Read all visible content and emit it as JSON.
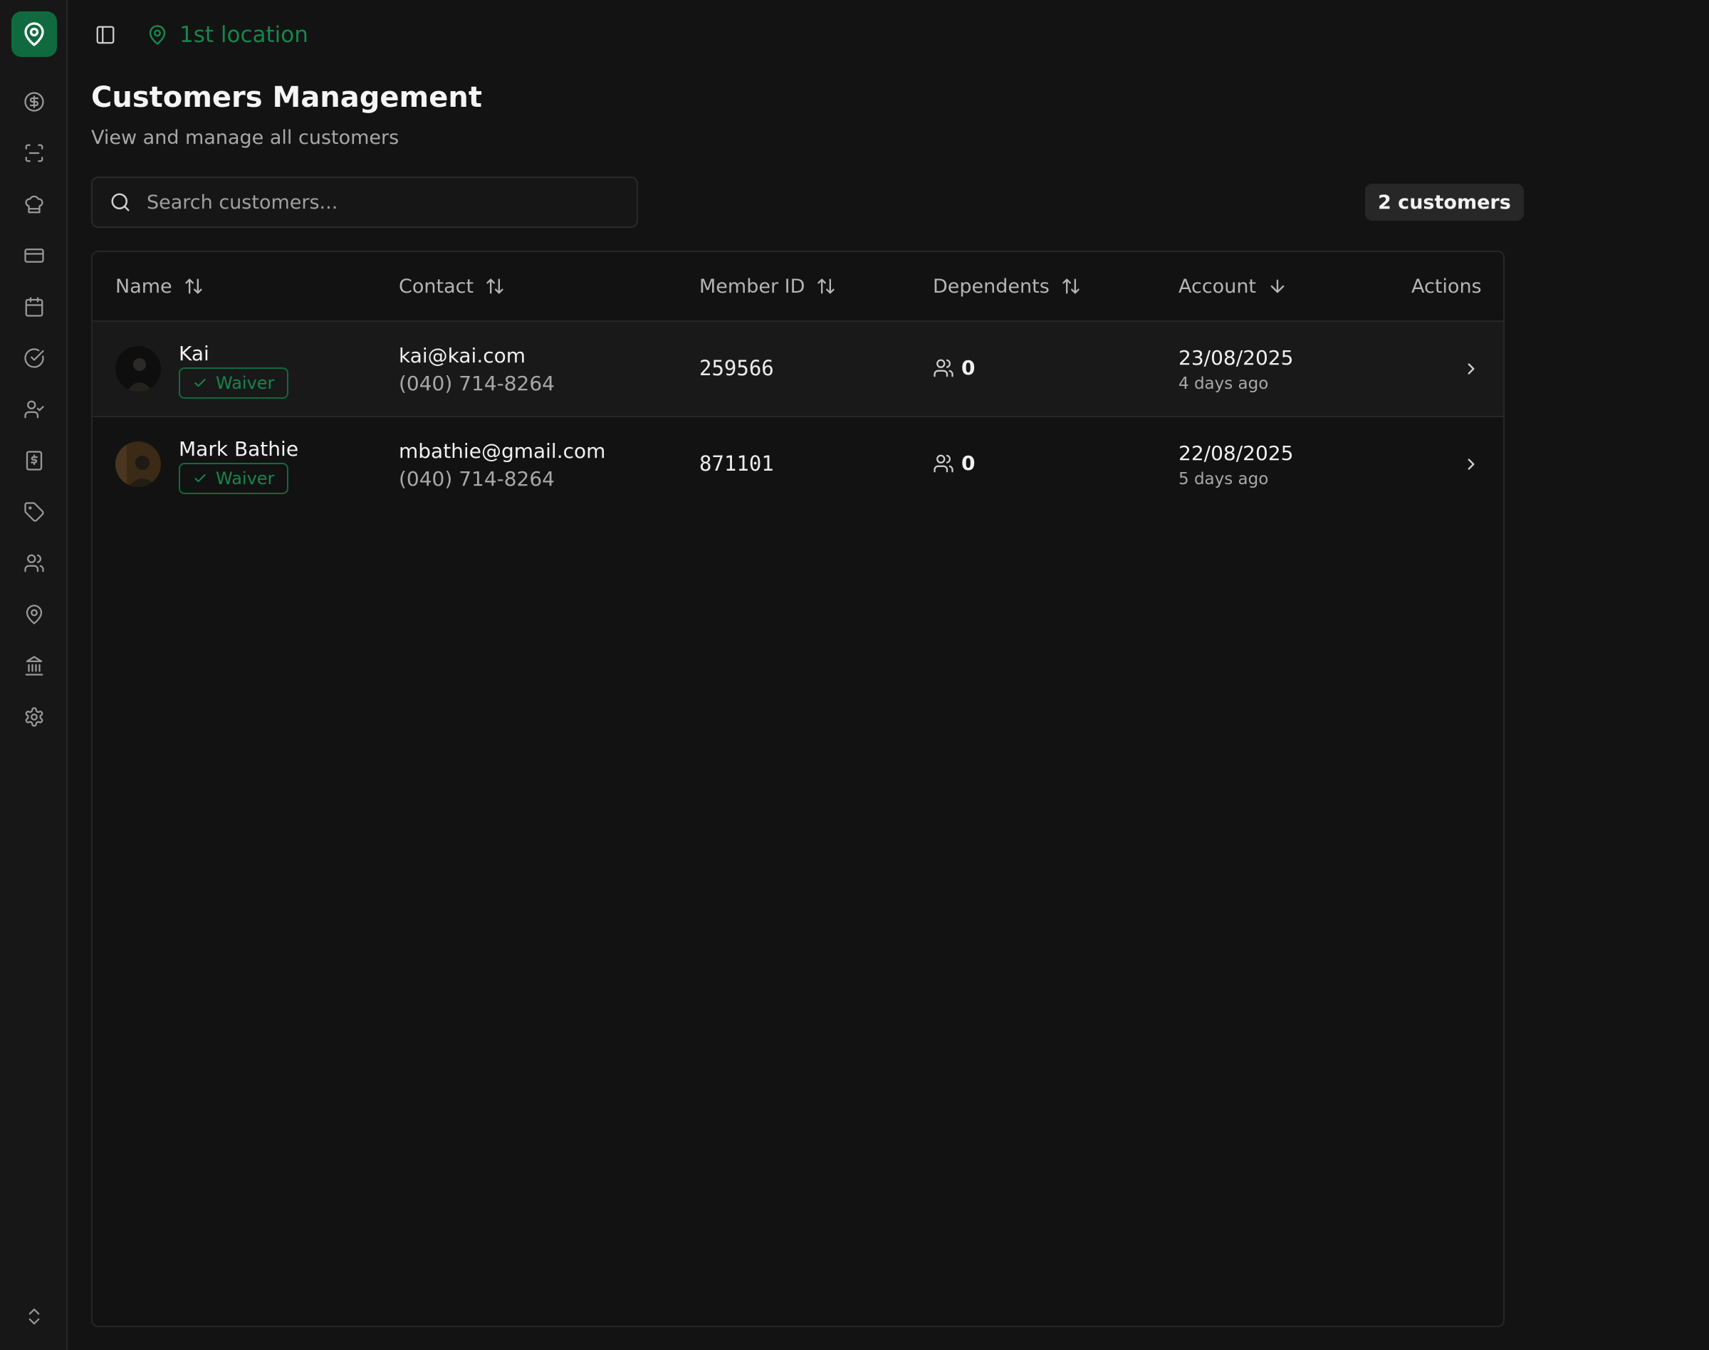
{
  "header": {
    "location_label": "1st location"
  },
  "sidebar": {
    "items": [
      {
        "icon": "dollar-circle-icon"
      },
      {
        "icon": "scan-icon"
      },
      {
        "icon": "chef-hat-icon"
      },
      {
        "icon": "credit-card-icon"
      },
      {
        "icon": "calendar-icon"
      },
      {
        "icon": "check-circle-icon"
      },
      {
        "icon": "user-check-icon"
      },
      {
        "icon": "receipt-dollar-icon"
      },
      {
        "icon": "tag-icon"
      },
      {
        "icon": "users-icon"
      },
      {
        "icon": "map-pin-icon"
      },
      {
        "icon": "bank-icon"
      },
      {
        "icon": "settings-icon"
      }
    ],
    "footer_icon": "chevrons-up-down-icon"
  },
  "page": {
    "title": "Customers Management",
    "subtitle": "View and manage all customers"
  },
  "search": {
    "placeholder": "Search customers..."
  },
  "count_badge": "2 customers",
  "table": {
    "columns": [
      {
        "label": "Name",
        "sort": "sortable"
      },
      {
        "label": "Contact",
        "sort": "sortable"
      },
      {
        "label": "Member ID",
        "sort": "sortable"
      },
      {
        "label": "Dependents",
        "sort": "sortable"
      },
      {
        "label": "Account",
        "sort": "descending"
      },
      {
        "label": "Actions",
        "sort": "none"
      }
    ],
    "rows": [
      {
        "name": "Kai",
        "badge": "Waiver",
        "email": "kai@kai.com",
        "phone": "(040) 714-8264",
        "member_id": "259566",
        "dependents": "0",
        "date": "23/08/2025",
        "relative": "4 days ago"
      },
      {
        "name": "Mark Bathie",
        "badge": "Waiver",
        "email": "mbathie@gmail.com",
        "phone": "(040) 714-8264",
        "member_id": "871101",
        "dependents": "0",
        "date": "22/08/2025",
        "relative": "5 days ago"
      }
    ]
  },
  "colors": {
    "background": "#131313",
    "sidebar": "#171717",
    "accent": "#0f6b3f",
    "accent_text": "#17854d",
    "border": "#262626"
  }
}
